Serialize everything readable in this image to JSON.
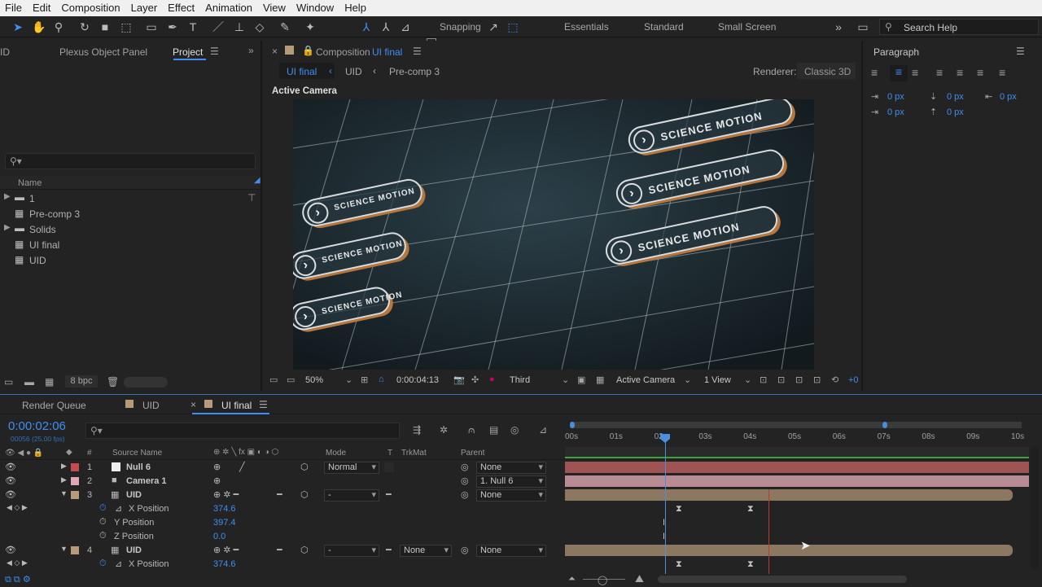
{
  "menu": [
    "File",
    "Edit",
    "Composition",
    "Layer",
    "Effect",
    "Animation",
    "View",
    "Window",
    "Help"
  ],
  "toolbar": {
    "snapping_label": "Snapping",
    "workspaces": [
      "Essentials",
      "Standard",
      "Small Screen"
    ],
    "search_placeholder": "Search Help"
  },
  "left_panel": {
    "tabs": [
      "ID",
      "Plexus Object Panel",
      "Project"
    ],
    "active_tab": "Project",
    "column_name": "Name",
    "items": [
      {
        "label": "1",
        "type": "folder"
      },
      {
        "label": "Pre-comp 3",
        "type": "comp"
      },
      {
        "label": "Solids",
        "type": "folder"
      },
      {
        "label": "UI final",
        "type": "comp"
      },
      {
        "label": "UID",
        "type": "comp"
      }
    ],
    "bpc": "8 bpc"
  },
  "composition": {
    "tab_prefix": "Composition",
    "tab_name": "UI final",
    "breadcrumbs": [
      "UI final",
      "UID",
      "Pre-comp 3"
    ],
    "renderer_label": "Renderer:",
    "renderer_value": "Classic 3D",
    "view_label": "Active Camera",
    "buttons": [
      {
        "label": "SCIENCE MOTION"
      },
      {
        "label": "SCIENCE MOTION"
      },
      {
        "label": "SCIENCE MOTION"
      },
      {
        "label": "SCIENCE MOTION"
      },
      {
        "label": "SCIENCE MOTION"
      },
      {
        "label": "SCIENCE MOTION"
      }
    ],
    "footer": {
      "zoom": "50%",
      "timecode": "0:00:04:13",
      "resolution": "Third",
      "camera": "Active Camera",
      "views": "1 View",
      "exposure": "+0"
    }
  },
  "paragraph": {
    "title": "Paragraph",
    "fields": [
      "0 px",
      "0 px",
      "0 px",
      "0 px",
      "0 px"
    ]
  },
  "timeline": {
    "tabs": [
      "Render Queue",
      "UID",
      "UI final"
    ],
    "active_tab": "UI final",
    "timecode": "0:00:02:06",
    "frame_info": "00056 (25.00 fps)",
    "columns": {
      "num": "#",
      "source": "Source Name",
      "mode": "Mode",
      "t": "T",
      "trkmat": "TrkMat",
      "parent": "Parent"
    },
    "ruler": [
      "00s",
      "01s",
      "02s",
      "03s",
      "04s",
      "05s",
      "06s",
      "07s",
      "08s",
      "09s",
      "10s"
    ],
    "layers": [
      {
        "num": "1",
        "name": "Null 6",
        "color": "#c94a4a",
        "mode": "Normal",
        "parent": "None",
        "expanded": false
      },
      {
        "num": "2",
        "name": "Camera 1",
        "color": "#e0a8b4",
        "mode": "",
        "parent": "1. Null 6",
        "expanded": false
      },
      {
        "num": "3",
        "name": "UID",
        "color": "#b89a78",
        "mode": "-",
        "parent": "None",
        "expanded": true
      },
      {
        "num": "4",
        "name": "UID",
        "color": "#b89a78",
        "mode": "-",
        "trkmat": "None",
        "parent": "None",
        "expanded": true
      }
    ],
    "properties": [
      {
        "name": "X Position",
        "value": "374.6"
      },
      {
        "name": "Y Position",
        "value": "397.4"
      },
      {
        "name": "Z Position",
        "value": "0.0"
      },
      {
        "name": "X Position",
        "value": "374.6"
      }
    ]
  },
  "colors": {
    "accent": "#3f8ef5",
    "bg": "#232323",
    "playhead": "#4a8fe0",
    "red_marker": "#c0392b"
  }
}
